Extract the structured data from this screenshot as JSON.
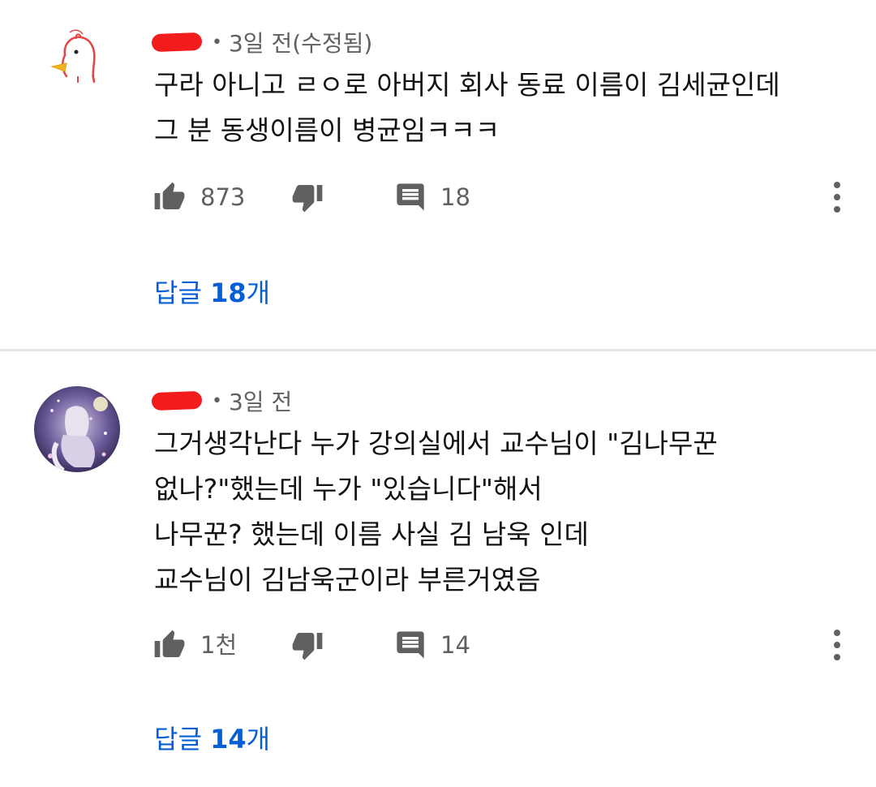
{
  "comments": [
    {
      "author_tail": "",
      "time": "3일 전(수정됨)",
      "lines": [
        "구라 아니고 ㄹㅇ로 아버지 회사 동료 이름이 김세균인데",
        "그 분 동생이름이 병균임ㅋㅋㅋ"
      ],
      "likes": "873",
      "replies_count": "18",
      "replies_prefix": "답글 ",
      "replies_number": "18",
      "replies_suffix": "개",
      "avatar_icon": "chick-drawing-avatar"
    },
    {
      "author_tail": "",
      "time": "3일 전",
      "lines": [
        "그거생각난다 누가 강의실에서 교수님이 \"김나무꾼",
        "없나?\"했는데 누가 \"있습니다\"해서",
        "나무꾼? 했는데 이름 사실 김 남욱 인데",
        "교수님이 김남욱군이라 부른거였음"
      ],
      "likes": "1천",
      "replies_count": "14",
      "replies_prefix": "답글 ",
      "replies_number": "14",
      "replies_suffix": "개",
      "avatar_icon": "anime-illustration-avatar"
    }
  ],
  "icons": {
    "like": "thumbs-up-icon",
    "dislike": "thumbs-down-icon",
    "reply": "comment-icon",
    "more": "more-vertical-icon"
  },
  "colors": {
    "link": "#065fd4",
    "meta": "#606060",
    "text": "#121212",
    "redaction": "#f21c1c"
  }
}
